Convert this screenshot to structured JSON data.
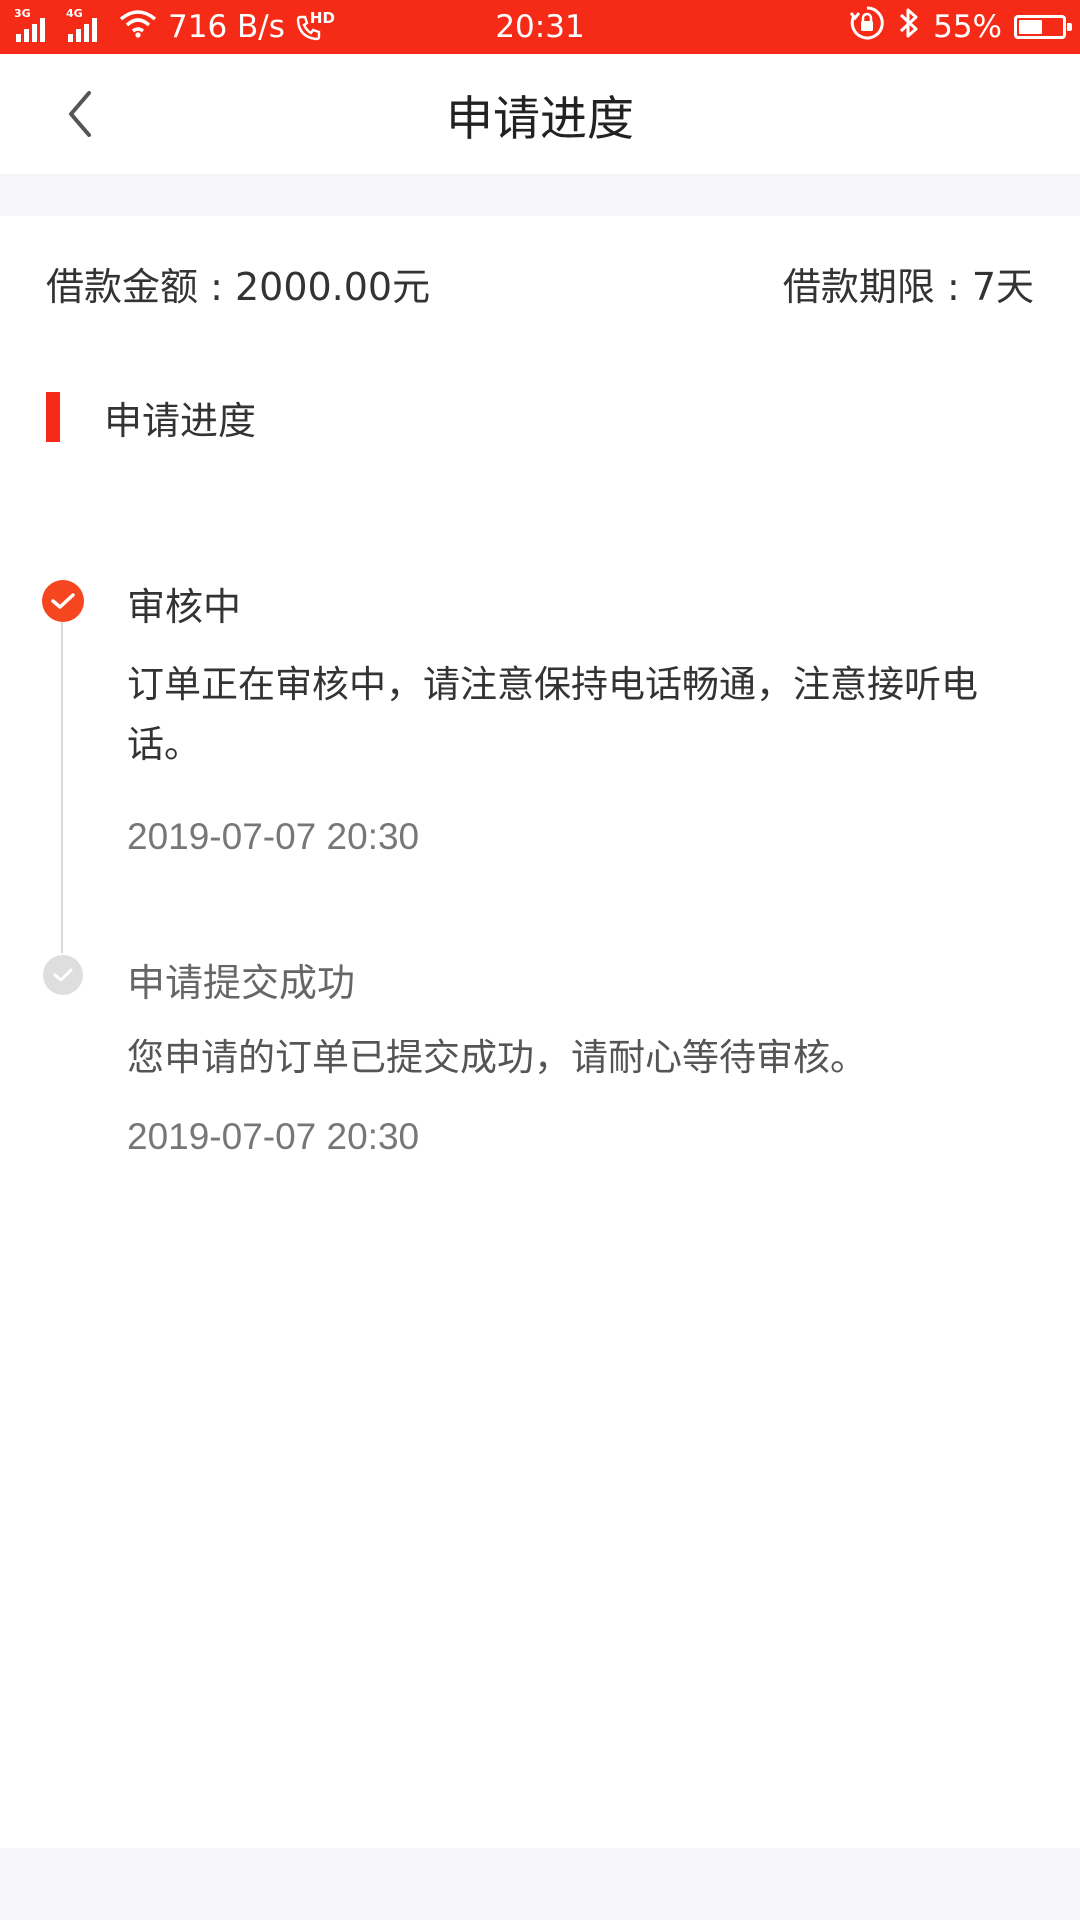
{
  "status_bar": {
    "net_type_1": "3G",
    "net_type_2": "4G",
    "speed": "716 B/s",
    "hd": "HD",
    "time": "20:31",
    "battery_text": "55%",
    "battery_level": 0.55,
    "icons": [
      "signal-3g-icon",
      "signal-4g-icon",
      "wifi-icon",
      "hd-call-icon",
      "rotation-lock-icon",
      "bluetooth-icon",
      "battery-icon"
    ]
  },
  "header": {
    "title": "申请进度",
    "back_icon": "chevron-left-icon"
  },
  "loan": {
    "amount_text": "借款金额 : 2000.00元",
    "term_text": "借款期限 : 7天"
  },
  "section": {
    "title": "申请进度"
  },
  "timeline": [
    {
      "title": "审核中",
      "description": "订单正在审核中，请注意保持电话畅通，注意接听电话。",
      "time": "2019-07-07 20:30",
      "state": "active"
    },
    {
      "title": "申请提交成功",
      "description": "您申请的订单已提交成功，请耐心等待审核。",
      "time": "2019-07-07 20:30",
      "state": "done"
    }
  ],
  "colors": {
    "accent": "#f52b18",
    "step_active": "#f5461f",
    "step_done": "#dedede",
    "band_gray": "#f6f5f7"
  }
}
